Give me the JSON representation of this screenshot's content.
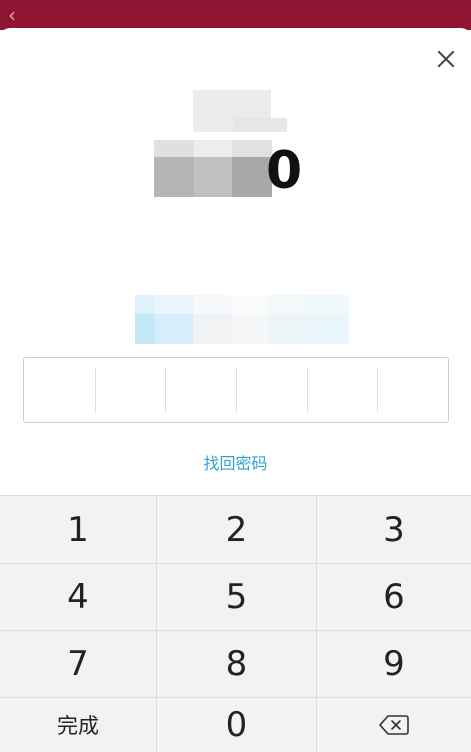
{
  "header": {
    "back_icon": "chevron-left-icon",
    "title_obscured": true
  },
  "dialog": {
    "close_icon": "close-icon",
    "amount_visible_tail": "0",
    "pin_digits": 6,
    "forgot_password": "找回密码"
  },
  "keypad": {
    "keys": [
      "1",
      "2",
      "3",
      "4",
      "5",
      "6",
      "7",
      "8",
      "9"
    ],
    "done_label": "完成",
    "zero_label": "0",
    "backspace_icon": "backspace-icon"
  },
  "colors": {
    "header_bg": "#8e1432",
    "link": "#2fa3c9",
    "keypad_bg": "#f2f2f2"
  }
}
